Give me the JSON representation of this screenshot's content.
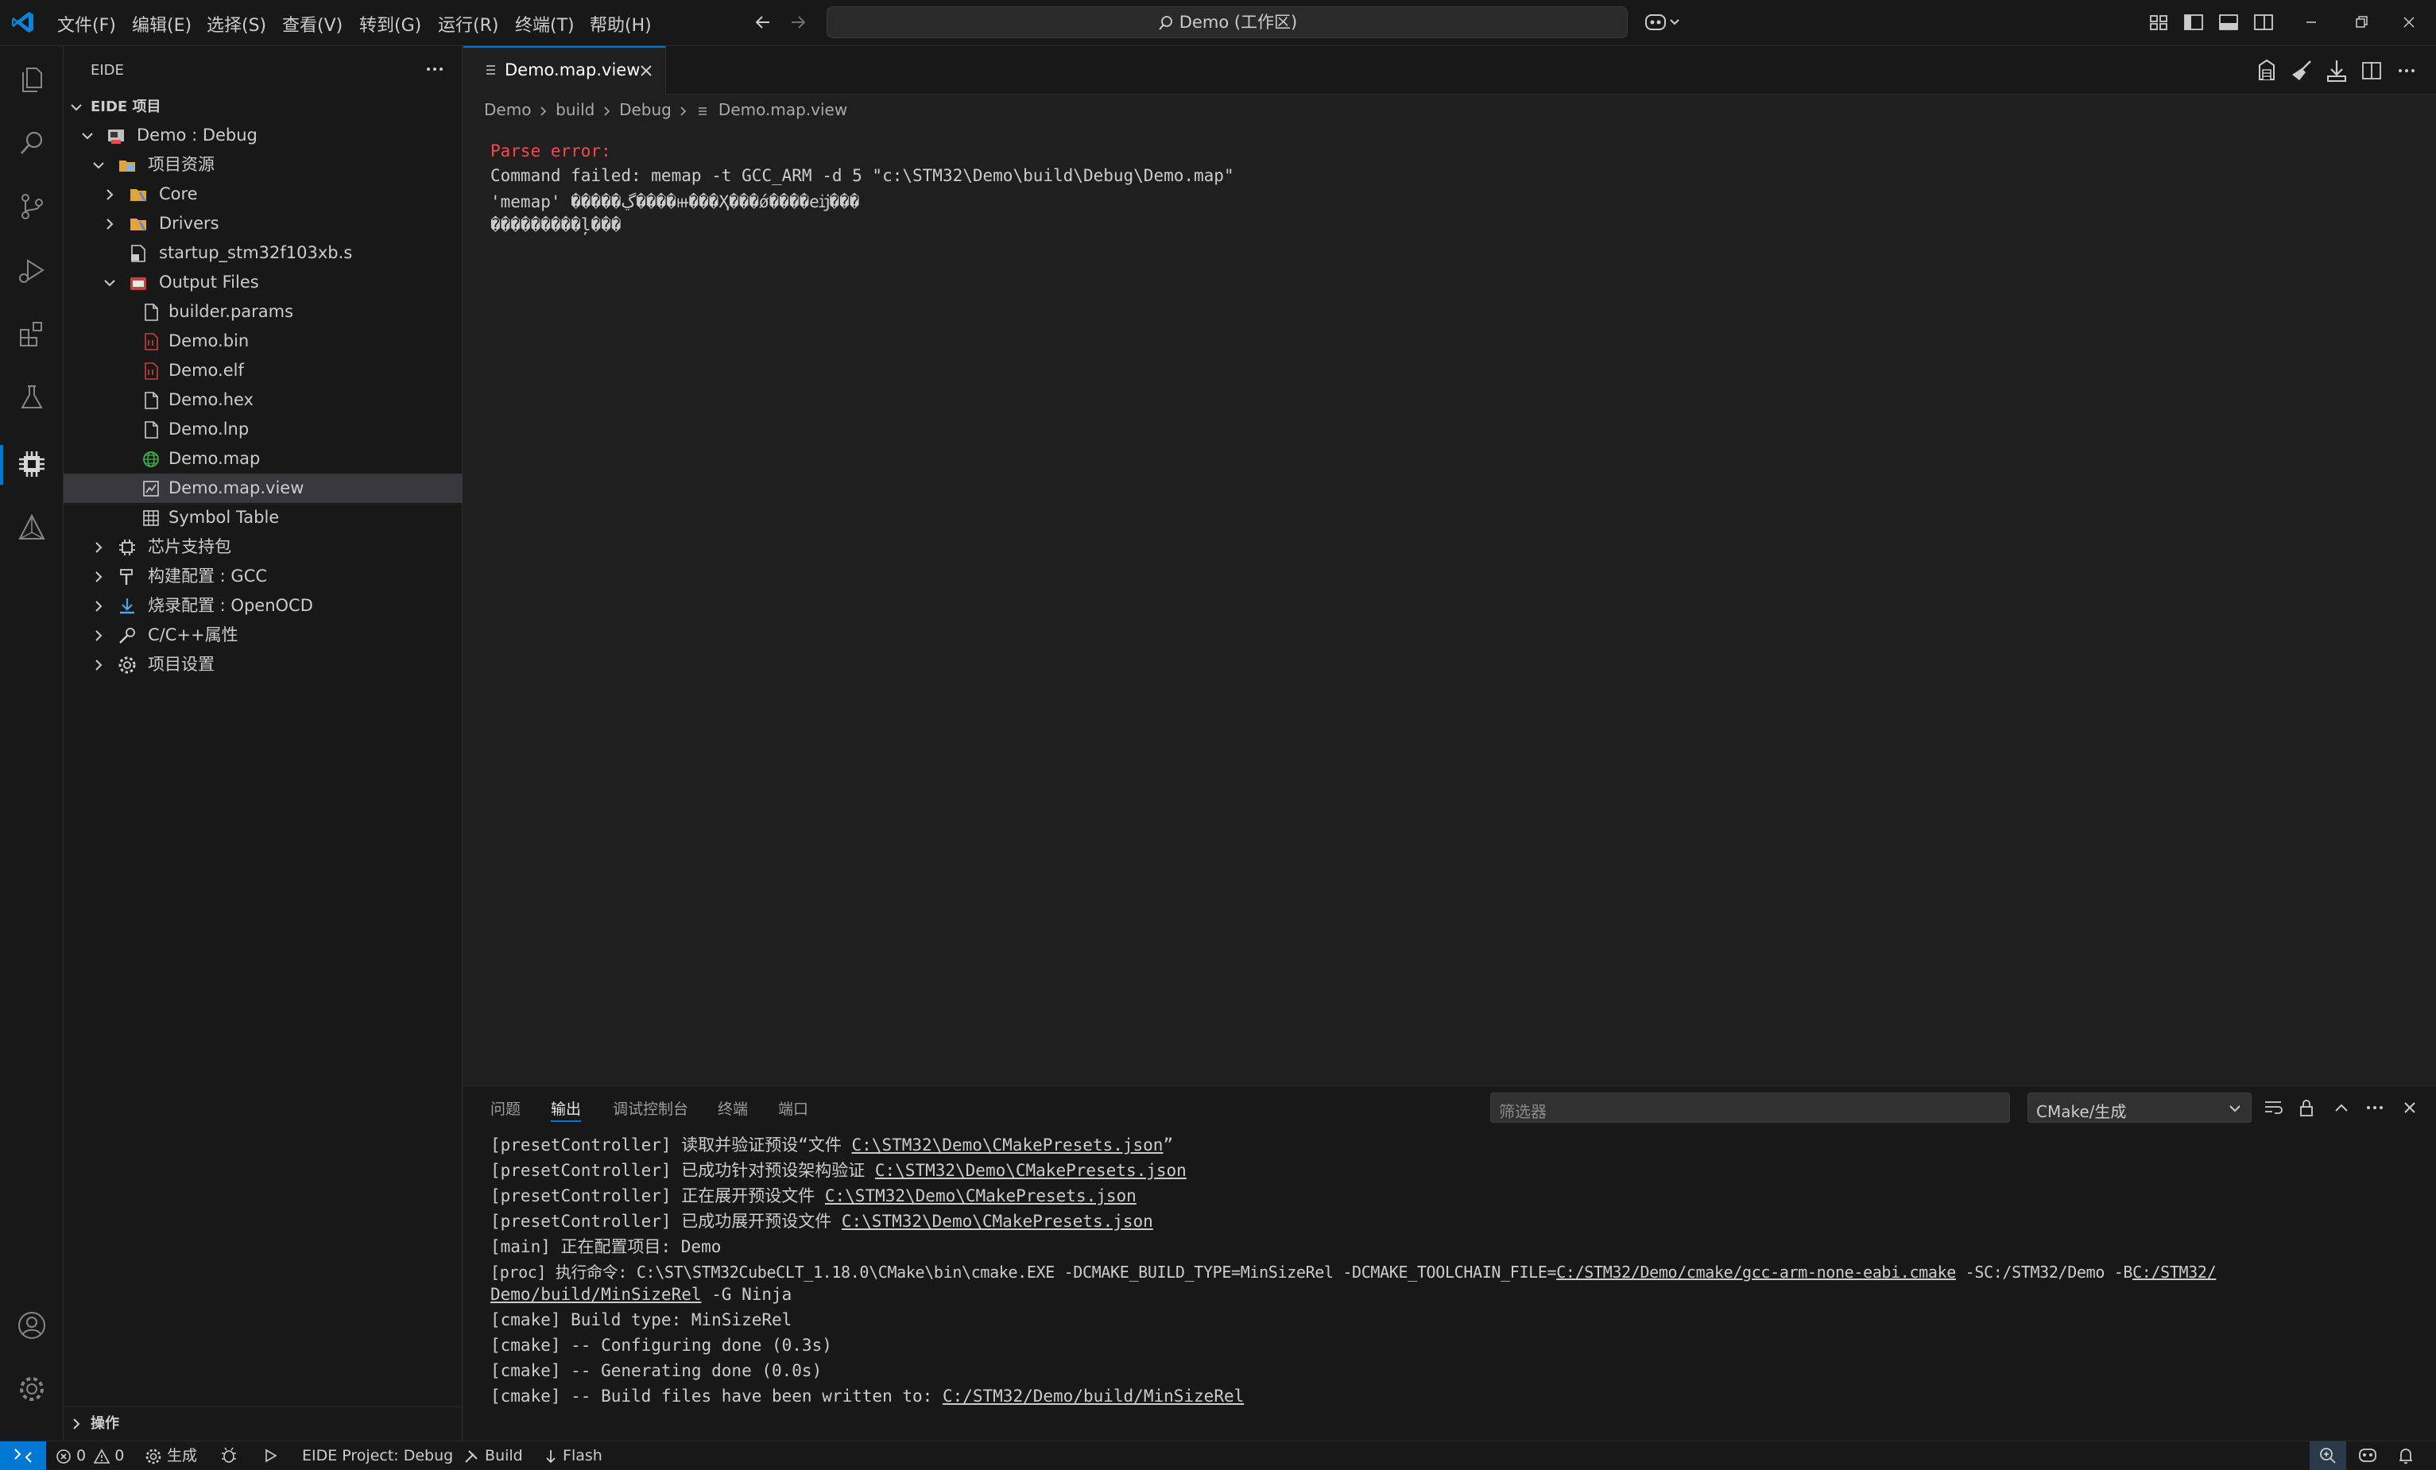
{
  "titlebar": {
    "menus": [
      "文件(F)",
      "编辑(E)",
      "选择(S)",
      "查看(V)",
      "转到(G)",
      "运行(R)",
      "终端(T)",
      "帮助(H)"
    ],
    "search_text": "Demo (工作区)"
  },
  "sidebar": {
    "title": "EIDE",
    "section_title": "EIDE 项目",
    "tree": [
      {
        "label": "Demo : Debug"
      },
      {
        "label": "项目资源"
      },
      {
        "label": "Core"
      },
      {
        "label": "Drivers"
      },
      {
        "label": "startup_stm32f103xb.s"
      },
      {
        "label": "Output Files"
      },
      {
        "label": "builder.params"
      },
      {
        "label": "Demo.bin"
      },
      {
        "label": "Demo.elf"
      },
      {
        "label": "Demo.hex"
      },
      {
        "label": "Demo.lnp"
      },
      {
        "label": "Demo.map"
      },
      {
        "label": "Demo.map.view"
      },
      {
        "label": "Symbol Table"
      },
      {
        "label": "芯片支持包"
      },
      {
        "label": "构建配置 : GCC"
      },
      {
        "label": "烧录配置 : OpenOCD"
      },
      {
        "label": "C/C++属性"
      },
      {
        "label": "项目设置"
      }
    ],
    "bottom_section": "操作"
  },
  "editor": {
    "tab_label": "Demo.map.view",
    "breadcrumb": [
      "Demo",
      "build",
      "Debug",
      "Demo.map.view"
    ],
    "lines": [
      "Parse error:",
      "Command failed: memap -t GCC_ARM -d 5 \"c:\\STM32\\Demo\\build\\Debug\\Demo.map\"",
      "'memap' �����ڲ����ⲿ���Ҳ���ǿ����еĳ���",
      "���������ļ���"
    ]
  },
  "panel": {
    "tabs": [
      "问题",
      "输出",
      "调试控制台",
      "终端",
      "端口"
    ],
    "filter_placeholder": "筛选器",
    "channel": "CMake/生成",
    "lines": [
      {
        "pre": "[presetController] 读取并验证预设“文件 ",
        "link": "C:\\STM32\\Demo\\CMakePresets.json",
        "post": "”"
      },
      {
        "pre": "[presetController] 已成功针对预设架构验证 ",
        "link": "C:\\STM32\\Demo\\CMakePresets.json",
        "post": ""
      },
      {
        "pre": "[presetController] 正在展开预设文件 ",
        "link": "C:\\STM32\\Demo\\CMakePresets.json",
        "post": ""
      },
      {
        "pre": "[presetController] 已成功展开预设文件 ",
        "link": "C:\\STM32\\Demo\\CMakePresets.json",
        "post": ""
      },
      {
        "pre": "[main] 正在配置项目: Demo",
        "link": "",
        "post": ""
      },
      {
        "pre": "[proc] 执行命令: C:\\ST\\STM32CubeCLT_1.18.0\\CMake\\bin\\cmake.EXE -DCMAKE_BUILD_TYPE=MinSizeRel -DCMAKE_TOOLCHAIN_FILE=",
        "link": "C:/STM32/Demo/cmake/gcc-arm-none-eabi.cmake",
        "post": " -SC:/STM32/Demo -B",
        "link2": "C:/STM32/"
      },
      {
        "pre": "",
        "link": "Demo/build/MinSizeRel",
        "post": " -G Ninja"
      },
      {
        "pre": "[cmake] Build type: MinSizeRel",
        "link": "",
        "post": ""
      },
      {
        "pre": "[cmake] -- Configuring done (0.3s)",
        "link": "",
        "post": ""
      },
      {
        "pre": "[cmake] -- Generating done (0.0s)",
        "link": "",
        "post": ""
      },
      {
        "pre": "[cmake] -- Build files have been written to: ",
        "link": "C:/STM32/Demo/build/MinSizeRel",
        "post": ""
      }
    ]
  },
  "statusbar": {
    "errors": "0",
    "warnings": "0",
    "build_label": "生成",
    "project": "EIDE Project: Debug",
    "build": "Build",
    "flash": "Flash"
  },
  "colors": {
    "accent": "#0078d4",
    "error": "#f14c4c",
    "bg": "#1f1f1f",
    "sidebar": "#181818"
  }
}
